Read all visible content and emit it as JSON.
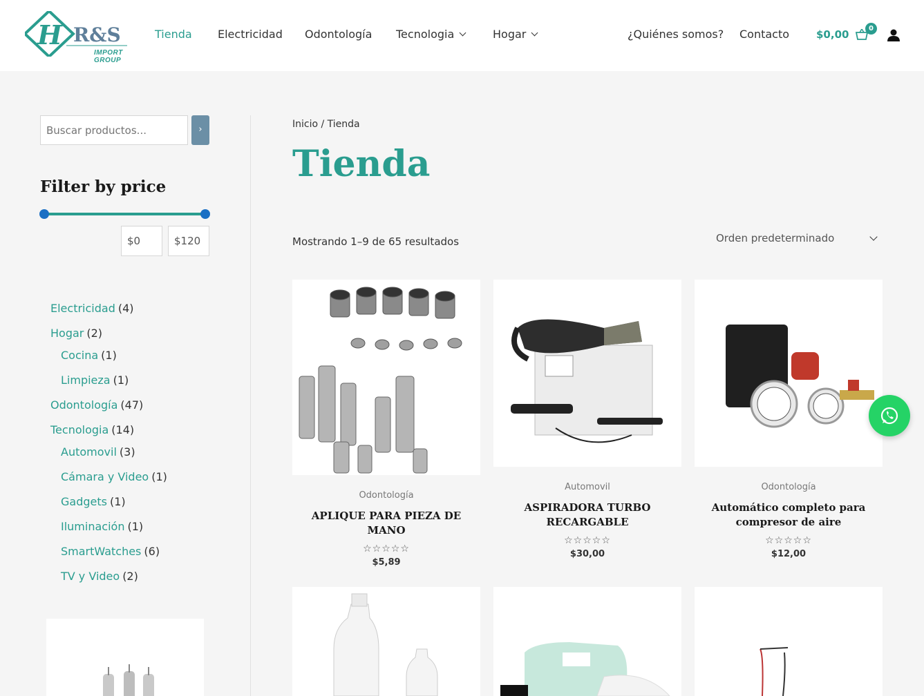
{
  "brand": {
    "logo_text": "IMPORT GROUP",
    "logo_letters": "R&S",
    "accent": "#2a9d8f"
  },
  "nav": {
    "items": [
      {
        "label": "Tienda",
        "active": true
      },
      {
        "label": "Electricidad"
      },
      {
        "label": "Odontología"
      },
      {
        "label": "Tecnologia",
        "dropdown": true
      },
      {
        "label": "Hogar",
        "dropdown": true
      }
    ],
    "right_items": [
      {
        "label": "¿Quiénes somos?"
      },
      {
        "label": "Contacto"
      }
    ],
    "cart_amount": "$0,00",
    "cart_count": "0"
  },
  "sidebar": {
    "search_placeholder": "Buscar productos...",
    "search_button": "›",
    "filter_title": "Filter by price",
    "price_min": "$0",
    "price_max": "$120",
    "categories": [
      {
        "name": "Electricidad",
        "count": "(4)"
      },
      {
        "name": "Hogar",
        "count": "(2)"
      },
      {
        "name": "Cocina",
        "count": "(1)",
        "child": true
      },
      {
        "name": "Limpieza",
        "count": "(1)",
        "child": true
      },
      {
        "name": "Odontología",
        "count": "(47)"
      },
      {
        "name": "Tecnologia",
        "count": "(14)"
      },
      {
        "name": "Automovil",
        "count": "(3)",
        "child": true
      },
      {
        "name": "Cámara y Video",
        "count": "(1)",
        "child": true
      },
      {
        "name": "Gadgets",
        "count": "(1)",
        "child": true
      },
      {
        "name": "Iluminación",
        "count": "(1)",
        "child": true
      },
      {
        "name": "SmartWatches",
        "count": "(6)",
        "child": true
      },
      {
        "name": "TV y Video",
        "count": "(2)",
        "child": true
      }
    ]
  },
  "main": {
    "breadcrumb_home": "Inicio",
    "breadcrumb_sep": " / ",
    "breadcrumb_current": "Tienda",
    "title": "Tienda",
    "results": "Mostrando 1–9 de 65 resultados",
    "orderby": "Orden predeterminado",
    "products": [
      {
        "category": "Odontología",
        "title": "APLIQUE PARA PIEZA DE MANO",
        "price": "$5,89",
        "stars": "☆☆☆☆☆"
      },
      {
        "category": "Automovil",
        "title": "ASPIRADORA TURBO RECARGABLE",
        "price": "$30,00",
        "stars": "☆☆☆☆☆"
      },
      {
        "category": "Odontología",
        "title": "Automático completo para compresor de aire",
        "price": "$12,00",
        "stars": "☆☆☆☆☆"
      }
    ]
  }
}
